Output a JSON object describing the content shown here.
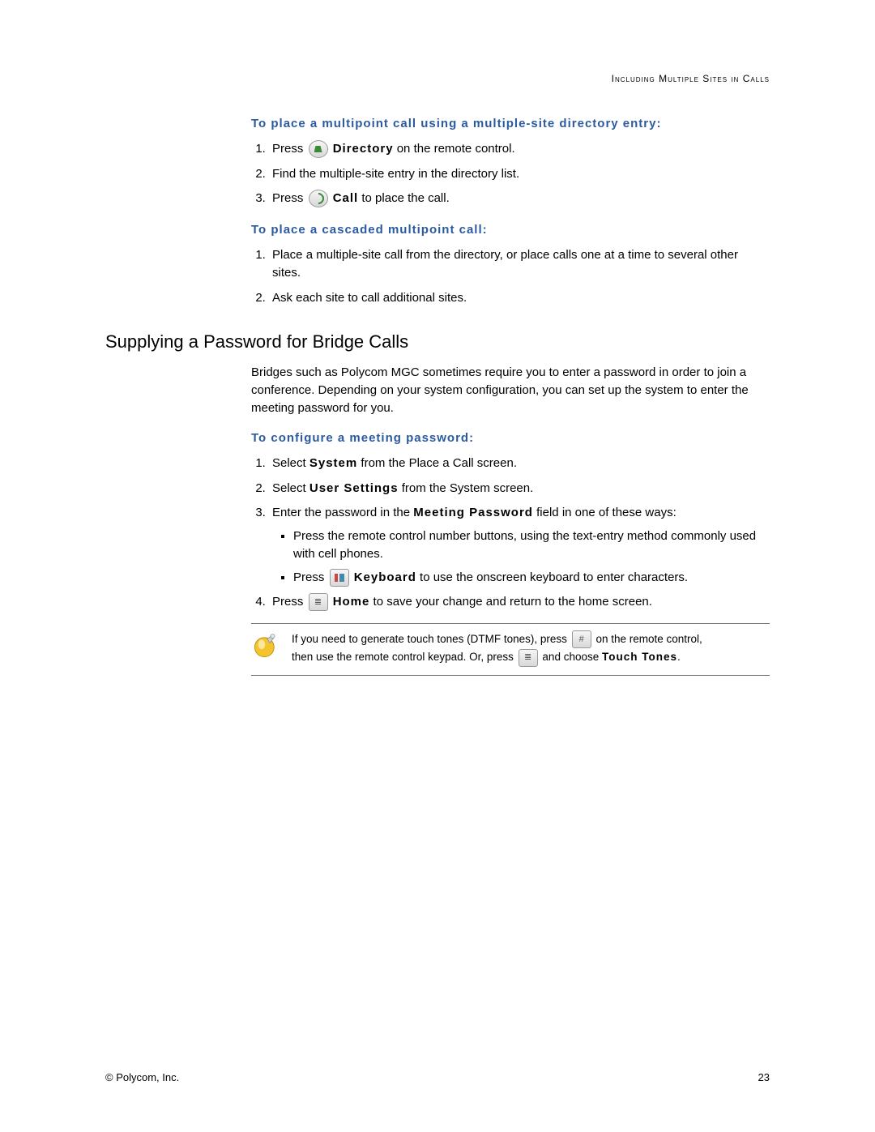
{
  "running_head": "Including Multiple Sites in Calls",
  "procA": {
    "heading": "To place a multipoint call using a multiple-site directory entry:",
    "step1_a": "Press ",
    "step1_b": "Directory",
    "step1_c": " on the remote control.",
    "step2": "Find the multiple-site entry in the directory list.",
    "step3_a": "Press ",
    "step3_b": "Call",
    "step3_c": " to place the call."
  },
  "procB": {
    "heading": "To place a cascaded multipoint call:",
    "step1": "Place a multiple-site call from the directory, or place calls one at a time to several other sites.",
    "step2": "Ask each site to call additional sites."
  },
  "section_heading": "Supplying a Password for Bridge Calls",
  "section_para": "Bridges such as Polycom MGC sometimes require you to enter a password in order to join a conference. Depending on your system configuration, you can set up the system to enter the meeting password for you.",
  "procC": {
    "heading": "To configure a meeting password:",
    "step1_a": "Select ",
    "step1_b": "System",
    "step1_c": " from the Place a Call screen.",
    "step2_a": "Select ",
    "step2_b": "User Settings",
    "step2_c": " from the System screen.",
    "step3_a": "Enter the password in the ",
    "step3_b": "Meeting Password",
    "step3_c": " field in one of these ways:",
    "sub1": "Press the remote control number buttons, using the text-entry method commonly used with cell phones.",
    "sub2_a": "Press ",
    "sub2_b": "Keyboard",
    "sub2_c": " to use the onscreen keyboard to enter characters.",
    "step4_a": "Press ",
    "step4_b": "Home",
    "step4_c": " to save your change and return to the home screen."
  },
  "note": {
    "line1_a": "If you need to generate touch tones (DTMF tones), press ",
    "line1_b": " on the remote control,",
    "line2_a": "then use the remote control keypad. Or, press ",
    "line2_b": " and choose ",
    "line2_c": "Touch Tones",
    "line2_d": "."
  },
  "footer_left": "© Polycom, Inc.",
  "footer_right": "23"
}
